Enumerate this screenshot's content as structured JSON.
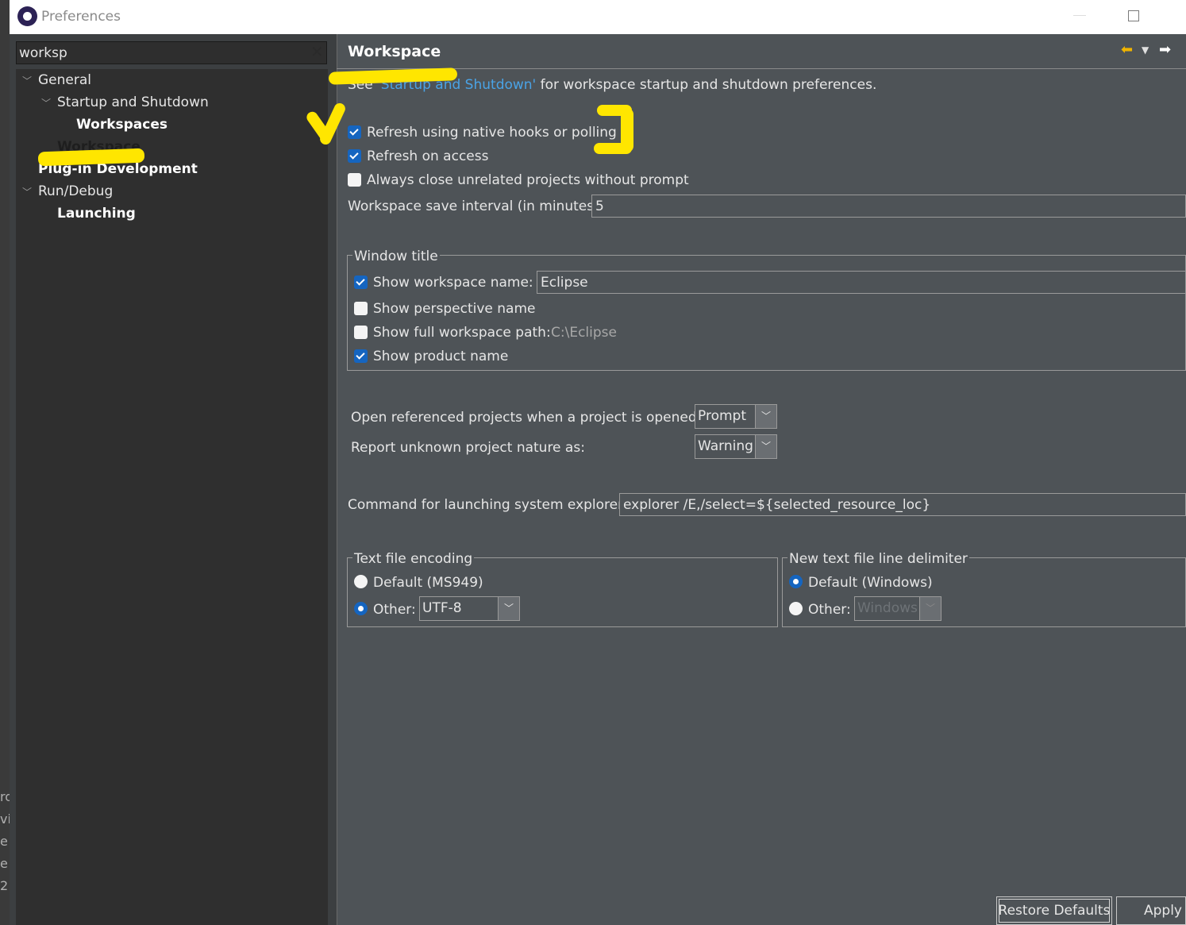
{
  "window": {
    "title": "Preferences"
  },
  "left_edge_text": "ro\nvi\ne\ne\n2",
  "filter": {
    "value": "worksp"
  },
  "tree": {
    "items": [
      {
        "label": "General"
      },
      {
        "label": "Startup and Shutdown"
      },
      {
        "label": "Workspaces"
      },
      {
        "label": "Workspace"
      },
      {
        "label": "Plug-in Development"
      },
      {
        "label": "Run/Debug"
      },
      {
        "label": "Launching"
      }
    ]
  },
  "page": {
    "title": "Workspace",
    "intro": {
      "prefix": "See ",
      "link": "'Startup and Shutdown'",
      "suffix": " for workspace startup and shutdown preferences."
    },
    "refresh_native": {
      "label": "Refresh using native hooks or polling",
      "checked": true
    },
    "refresh_access": {
      "label": "Refresh on access",
      "checked": true
    },
    "close_unrelated": {
      "label": "Always close unrelated projects without prompt",
      "checked": false
    },
    "save_interval": {
      "label": "Workspace save interval (in minutes):",
      "value": "5"
    },
    "window_title": {
      "title": "Window title",
      "show_workspace_name": {
        "label": "Show workspace name:",
        "checked": true,
        "value": "Eclipse"
      },
      "show_perspective_name": {
        "label": "Show perspective name",
        "checked": false
      },
      "show_full_path": {
        "label": "Show full workspace path:",
        "checked": false,
        "path": "C:\\Eclipse"
      },
      "show_product_name": {
        "label": "Show product name",
        "checked": true
      }
    },
    "open_referenced": {
      "label": "Open referenced projects when a project is opened:",
      "value": "Prompt"
    },
    "report_unknown": {
      "label": "Report unknown project nature as:",
      "value": "Warning"
    },
    "explorer_command": {
      "label": "Command for launching system explorer:",
      "value": "explorer /E,/select=${selected_resource_loc}"
    },
    "text_encoding": {
      "title": "Text file encoding",
      "default_label": "Default (MS949)",
      "other_label": "Other:",
      "other_value": "UTF-8",
      "selected": "other"
    },
    "line_delimiter": {
      "title": "New text file line delimiter",
      "default_label": "Default (Windows)",
      "other_label": "Other:",
      "other_value": "Windows",
      "selected": "default"
    }
  },
  "buttons": {
    "restore_defaults": "Restore Defaults",
    "apply": "Apply"
  },
  "colors": {
    "highlighter": "#ffe600",
    "link": "#4aa3e6",
    "checkbox_on": "#1565c0"
  }
}
